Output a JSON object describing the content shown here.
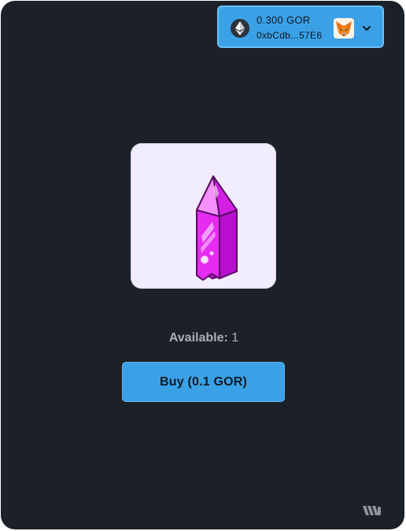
{
  "wallet": {
    "balance": "0.300 GOR",
    "address": "0xbCdb...57E6",
    "network_icon": "ethereum-icon",
    "wallet_icon": "metamask-fox-icon",
    "dropdown_icon": "chevron-down-icon"
  },
  "item": {
    "image": "pink-crystal"
  },
  "availability": {
    "label": "Available:",
    "count": "1"
  },
  "buy_button": {
    "label": "Buy (0.1 GOR)"
  },
  "footer": {
    "brand_icon": "brand-logo-icon"
  },
  "colors": {
    "background": "#1c2129",
    "accent": "#3aa1e6",
    "item_bg": "#f1edfe",
    "crystal": "#d61fe6"
  }
}
